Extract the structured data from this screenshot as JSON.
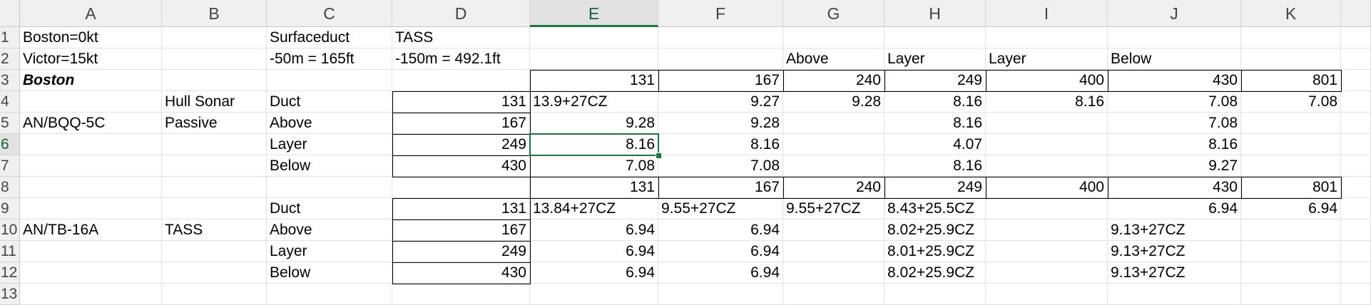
{
  "columns": [
    "A",
    "B",
    "C",
    "D",
    "E",
    "F",
    "G",
    "H",
    "I",
    "J",
    "K"
  ],
  "rows": [
    "1",
    "2",
    "3",
    "4",
    "5",
    "6",
    "7",
    "8",
    "9",
    "10",
    "11",
    "12",
    "13"
  ],
  "selected": {
    "column": "E",
    "row": "6"
  },
  "accent_color": "#217346",
  "cells": [
    {
      "id": "A1",
      "text": "Boston=0kt"
    },
    {
      "id": "C1",
      "text": "Surfaceduct"
    },
    {
      "id": "D1",
      "text": "TASS"
    },
    {
      "id": "A2",
      "text": "Victor=15kt"
    },
    {
      "id": "C2",
      "text": "-50m = 165ft"
    },
    {
      "id": "D2",
      "text": "-150m = 492.1ft"
    },
    {
      "id": "G2",
      "text": "Above"
    },
    {
      "id": "H2",
      "text": "Layer"
    },
    {
      "id": "I2",
      "text": "Layer"
    },
    {
      "id": "J2",
      "text": "Below"
    },
    {
      "id": "A3",
      "text": "Boston",
      "style": "bi"
    },
    {
      "id": "E3",
      "text": "131",
      "align": "r"
    },
    {
      "id": "F3",
      "text": "167",
      "align": "r"
    },
    {
      "id": "G3",
      "text": "240",
      "align": "r"
    },
    {
      "id": "H3",
      "text": "249",
      "align": "r"
    },
    {
      "id": "I3",
      "text": "400",
      "align": "r"
    },
    {
      "id": "J3",
      "text": "430",
      "align": "r"
    },
    {
      "id": "K3",
      "text": "801",
      "align": "r"
    },
    {
      "id": "B4",
      "text": "Hull Sonar"
    },
    {
      "id": "C4",
      "text": "Duct"
    },
    {
      "id": "D4",
      "text": "131",
      "align": "r"
    },
    {
      "id": "E4",
      "text": "13.9+27CZ"
    },
    {
      "id": "F4",
      "text": "9.27",
      "align": "r"
    },
    {
      "id": "G4",
      "text": "9.28",
      "align": "r"
    },
    {
      "id": "H4",
      "text": "8.16",
      "align": "r"
    },
    {
      "id": "I4",
      "text": "8.16",
      "align": "r"
    },
    {
      "id": "J4",
      "text": "7.08",
      "align": "r"
    },
    {
      "id": "K4",
      "text": "7.08",
      "align": "r"
    },
    {
      "id": "A5",
      "text": "AN/BQQ-5C"
    },
    {
      "id": "B5",
      "text": "Passive"
    },
    {
      "id": "C5",
      "text": "Above"
    },
    {
      "id": "D5",
      "text": "167",
      "align": "r"
    },
    {
      "id": "E5",
      "text": "9.28",
      "align": "r"
    },
    {
      "id": "F5",
      "text": "9.28",
      "align": "r"
    },
    {
      "id": "H5",
      "text": "8.16",
      "align": "r"
    },
    {
      "id": "J5",
      "text": "7.08",
      "align": "r"
    },
    {
      "id": "C6",
      "text": "Layer"
    },
    {
      "id": "D6",
      "text": "249",
      "align": "r"
    },
    {
      "id": "E6",
      "text": "8.16",
      "align": "r"
    },
    {
      "id": "F6",
      "text": "8.16",
      "align": "r"
    },
    {
      "id": "H6",
      "text": "4.07",
      "align": "r"
    },
    {
      "id": "J6",
      "text": "8.16",
      "align": "r"
    },
    {
      "id": "C7",
      "text": "Below"
    },
    {
      "id": "D7",
      "text": "430",
      "align": "r"
    },
    {
      "id": "E7",
      "text": "7.08",
      "align": "r"
    },
    {
      "id": "F7",
      "text": "7.08",
      "align": "r"
    },
    {
      "id": "H7",
      "text": "8.16",
      "align": "r"
    },
    {
      "id": "J7",
      "text": "9.27",
      "align": "r"
    },
    {
      "id": "E8",
      "text": "131",
      "align": "r"
    },
    {
      "id": "F8",
      "text": "167",
      "align": "r"
    },
    {
      "id": "G8",
      "text": "240",
      "align": "r"
    },
    {
      "id": "H8",
      "text": "249",
      "align": "r"
    },
    {
      "id": "I8",
      "text": "400",
      "align": "r"
    },
    {
      "id": "J8",
      "text": "430",
      "align": "r"
    },
    {
      "id": "K8",
      "text": "801",
      "align": "r"
    },
    {
      "id": "C9",
      "text": "Duct"
    },
    {
      "id": "D9",
      "text": "131",
      "align": "r"
    },
    {
      "id": "E9",
      "text": "13.84+27CZ"
    },
    {
      "id": "F9",
      "text": "9.55+27CZ"
    },
    {
      "id": "G9",
      "text": "9.55+27CZ"
    },
    {
      "id": "H9",
      "text": "8.43+25.5CZ"
    },
    {
      "id": "J9",
      "text": "6.94",
      "align": "r"
    },
    {
      "id": "K9",
      "text": "6.94",
      "align": "r"
    },
    {
      "id": "A10",
      "text": "AN/TB-16A"
    },
    {
      "id": "B10",
      "text": "TASS"
    },
    {
      "id": "C10",
      "text": "Above"
    },
    {
      "id": "D10",
      "text": "167",
      "align": "r"
    },
    {
      "id": "E10",
      "text": "6.94",
      "align": "r"
    },
    {
      "id": "F10",
      "text": "6.94",
      "align": "r"
    },
    {
      "id": "H10",
      "text": "8.02+25.9CZ"
    },
    {
      "id": "J10",
      "text": "9.13+27CZ"
    },
    {
      "id": "C11",
      "text": "Layer"
    },
    {
      "id": "D11",
      "text": "249",
      "align": "r"
    },
    {
      "id": "E11",
      "text": "6.94",
      "align": "r"
    },
    {
      "id": "F11",
      "text": "6.94",
      "align": "r"
    },
    {
      "id": "H11",
      "text": "8.01+25.9CZ"
    },
    {
      "id": "J11",
      "text": "9.13+27CZ"
    },
    {
      "id": "C12",
      "text": "Below"
    },
    {
      "id": "D12",
      "text": "430",
      "align": "r"
    },
    {
      "id": "E12",
      "text": "6.94",
      "align": "r"
    },
    {
      "id": "F12",
      "text": "6.94",
      "align": "r"
    },
    {
      "id": "H12",
      "text": "8.02+25.9CZ"
    },
    {
      "id": "J12",
      "text": "9.13+27CZ"
    }
  ]
}
